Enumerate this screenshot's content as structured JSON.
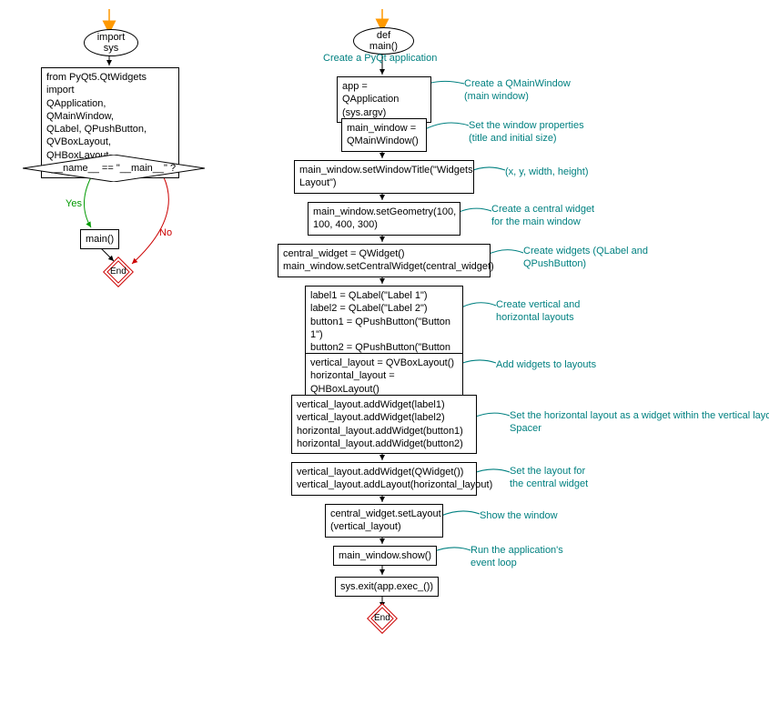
{
  "left": {
    "terminal1": "import sys",
    "box1": "from PyQt5.QtWidgets import\nQApplication, QMainWindow,\nQLabel, QPushButton,\nQVBoxLayout, QHBoxLayout,\nQWidget",
    "diamond1": "__name__ == \"__main__\" ?",
    "yes": "Yes",
    "no": "No",
    "box2": "main()",
    "end": "End"
  },
  "right": {
    "terminal1": "def main()",
    "ann1": "Create a PyQt application",
    "box1": "app = QApplication\n(sys.argv)",
    "ann_box1": "Create a QMainWindow\n(main window)",
    "box2": "main_window =\nQMainWindow()",
    "ann_box2": "Set the window properties\n(title and initial size)",
    "box3": "main_window.setWindowTitle(\"Widgets\nLayout\")",
    "ann_box3": "(x, y, width, height)",
    "box4": "main_window.setGeometry(100,\n100, 400, 300)",
    "ann_box4": "Create a central widget\nfor the main window",
    "box5": "central_widget = QWidget()\nmain_window.setCentralWidget(central_widget)",
    "ann_box5": "Create widgets (QLabel and\nQPushButton)",
    "box6": "label1 = QLabel(\"Label 1\")\nlabel2 = QLabel(\"Label 2\")\nbutton1 = QPushButton(\"Button 1\")\nbutton2 = QPushButton(\"Button 2\")",
    "ann_box6": "Create vertical and\nhorizontal layouts",
    "box7": "vertical_layout = QVBoxLayout()\nhorizontal_layout = QHBoxLayout()",
    "ann_box7": "Add widgets to layouts",
    "box8": "vertical_layout.addWidget(label1)\nvertical_layout.addWidget(label2)\nhorizontal_layout.addWidget(button1)\nhorizontal_layout.addWidget(button2)",
    "ann_box8": "Set the horizontal layout as a widget within the vertical layout\nSpacer",
    "box9": "vertical_layout.addWidget(QWidget())\nvertical_layout.addLayout(horizontal_layout)",
    "ann_box9": "Set the layout for\nthe central widget",
    "box10": "central_widget.setLayout\n(vertical_layout)",
    "ann_box10": "Show the window",
    "box11": "main_window.show()",
    "ann_box11": "Run the application's\nevent loop",
    "box12": "sys.exit(app.exec_())",
    "end": "End"
  }
}
